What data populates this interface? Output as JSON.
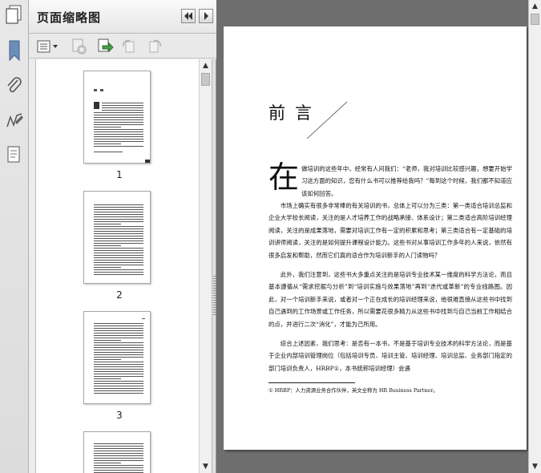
{
  "panel": {
    "title": "页面缩略图"
  },
  "thumbnails": [
    {
      "label": "1"
    },
    {
      "label": "2"
    },
    {
      "label": "3"
    }
  ],
  "page": {
    "heading": "前言",
    "dropcap": "在",
    "p1": "做培训的这些年中，经常有人问我们：“老师，我对培训比较感兴趣，想要开始学习这方面的知识，您有什么书可以推荐给我吗？”每到这个时候，我们都不知道应该如何回答。",
    "p2": "市场上确实有很多非常棒的有关培训的书，总体上可以分为三类：第一类适合培训总监和企业大学校长阅读，关注的是人才培养工作的战略承接、体系设计；第二类适合高阶培训经理阅读，关注的是成果落地，需要对培训工作有一定的积累和思考；第三类适合有一定基础的培训讲师阅读，关注的是如何提升课程设计能力。这些书对从事培训工作多年的人来说，依然有很多启发和帮助，然而它们真的适合作为培训新手的人门读物吗？",
    "p3": "此外，我们注意到，这些书大多重点关注的是培训专业技术某一维度的科学方法论，而且基本遵循从“需求挖掘与分析”到“培训实施与效果落地”再到“迭代或革新”的专业线路图。因此，对一个培训新手来说，或者对一个正在成长的培训经理来说，他很难直接从这些书中找到自己遇到的工作场景或工作任务，所以需要花很多精力从这些书中找到与自己当前工作相结合的点，并进行二次“消化”，才能为己所用。",
    "p4": "综合上述因素，我们思考：是否有一本书，不是基于培训专业技术的科学方法论，而是基于企业内部培训管理岗位（包括培训专员、培训主管、培训经理、培训总监、业务部门指定的部门培训负责人，HRBP①，本书统称培训经理）会遇",
    "footnote": "① HRBP：人力资源业务合作伙伴，英文全称为 HR Business Partner。"
  },
  "icons": {
    "rail": [
      "pages-icon",
      "bookmark-icon",
      "attachment-icon",
      "signature-icon",
      "layers-icon"
    ],
    "toolbar": [
      "thumbnail-options-icon",
      "delete-page-icon",
      "insert-page-icon",
      "rotate-ccw-icon",
      "rotate-cw-icon"
    ]
  },
  "colors": {
    "workspace": "#6e6e6e",
    "panel_bg": "#ececec",
    "page_bg": "#ffffff"
  }
}
